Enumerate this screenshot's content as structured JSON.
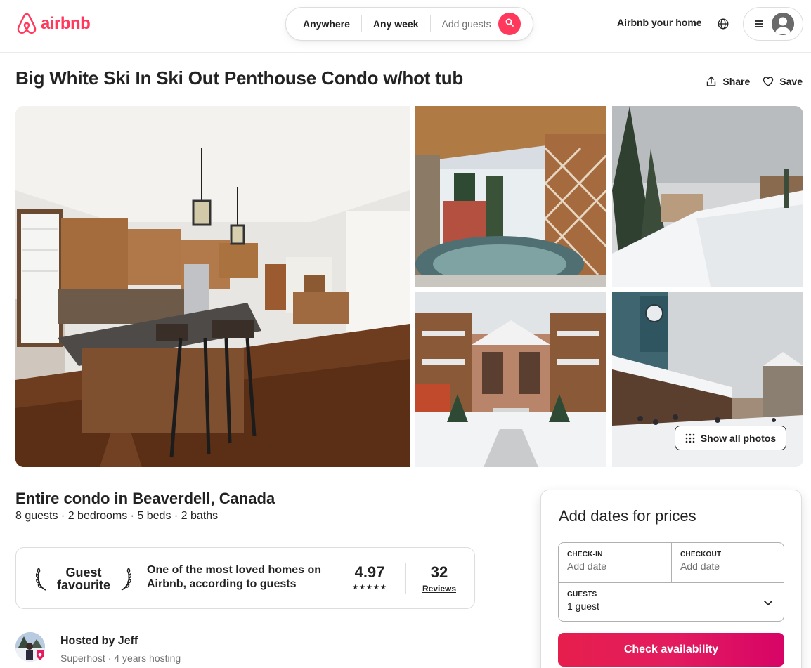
{
  "header": {
    "logo_text": "airbnb",
    "search": {
      "location": "Anywhere",
      "dates": "Any week",
      "guests_placeholder": "Add guests"
    },
    "host_link": "Airbnb your home",
    "icons": [
      "airbnb-logo-icon",
      "search-icon",
      "globe-icon",
      "hamburger-menu-icon",
      "user-avatar-icon"
    ]
  },
  "listing": {
    "title": "Big White Ski In Ski Out Penthouse Condo w/hot tub",
    "share_label": "Share",
    "save_label": "Save",
    "show_all_photos": "Show all photos",
    "subtitle": "Entire condo in Beaverdell, Canada",
    "meta": "8 guests · 2 bedrooms · 5 beds · 2 baths"
  },
  "guest_favourite": {
    "badge_line1": "Guest",
    "badge_line2": "favourite",
    "description": "One of the most loved homes on Airbnb, according to guests",
    "rating": "4.97",
    "stars": "★★★★★",
    "star_count": 5,
    "review_count": "32",
    "review_label": "Reviews"
  },
  "host": {
    "hosted_by": "Hosted by Jeff",
    "details": "Superhost · 4 years hosting"
  },
  "booking": {
    "title": "Add dates for prices",
    "checkin_label": "CHECK-IN",
    "checkin_value": "Add date",
    "checkout_label": "CHECKOUT",
    "checkout_value": "Add date",
    "guests_label": "GUESTS",
    "guests_value": "1 guest",
    "cta": "Check availability"
  },
  "colors": {
    "brand": "#ff385c",
    "cta_start": "#e61e4d",
    "cta_end": "#d70466",
    "text": "#222222",
    "muted": "#717171"
  }
}
